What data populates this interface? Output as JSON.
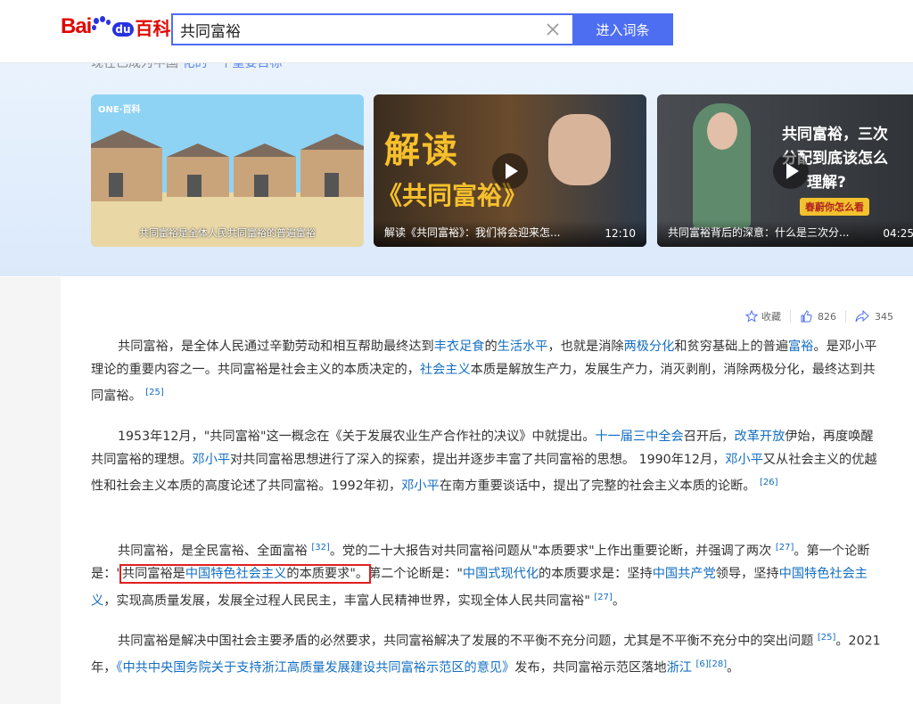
{
  "header": {
    "logo_bai": "Bai",
    "logo_du": "du",
    "logo_baike": "百科",
    "search_value": "共同富裕",
    "enter_button": "进入词条"
  },
  "hero": {
    "partial_text": "现在已成为中国",
    "partial_link": "化的一个重要目标",
    "videos": [
      {
        "thumb_text": "共同富裕是全体人民共同富裕的普遍富裕",
        "badge": "ONE·百科",
        "caption": "",
        "duration": ""
      },
      {
        "thumb_title": "解读",
        "thumb_subtitle": "《共同富裕》",
        "caption": "解读《共同富裕》：我们将会迎来怎...",
        "duration": "12:10"
      },
      {
        "thumb_title": "共同富裕，三次",
        "thumb_subtitle": "分配到底该怎么",
        "thumb_line3": "理解?",
        "badge": "春蔚你怎么看",
        "caption": "共同富裕背后的深意：什么是三次分...",
        "duration": "04:25"
      }
    ]
  },
  "actions": {
    "favorite": "收藏",
    "likes": "826",
    "shares": "345"
  },
  "colors": {
    "accent": "#4e6ef2",
    "link": "#136ec2",
    "brand_red": "#e10601",
    "highlight_box": "#e02020"
  }
}
